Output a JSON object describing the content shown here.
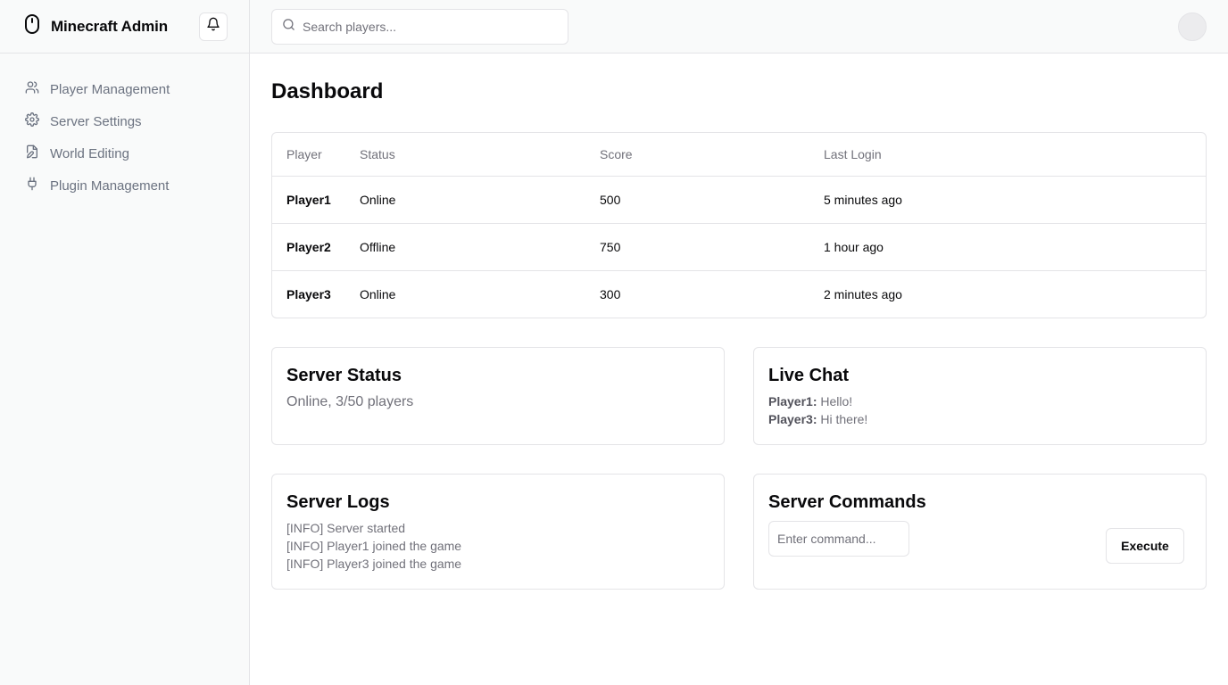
{
  "app": {
    "title": "Minecraft Admin"
  },
  "sidebar": {
    "items": [
      {
        "label": "Player Management",
        "icon": "users-icon"
      },
      {
        "label": "Server Settings",
        "icon": "gear-icon"
      },
      {
        "label": "World Editing",
        "icon": "file-edit-icon"
      },
      {
        "label": "Plugin Management",
        "icon": "plug-icon"
      }
    ]
  },
  "search": {
    "placeholder": "Search players..."
  },
  "main": {
    "title": "Dashboard",
    "table": {
      "headers": [
        "Player",
        "Status",
        "Score",
        "Last Login"
      ],
      "rows": [
        [
          "Player1",
          "Online",
          "500",
          "5 minutes ago"
        ],
        [
          "Player2",
          "Offline",
          "750",
          "1 hour ago"
        ],
        [
          "Player3",
          "Online",
          "300",
          "2 minutes ago"
        ]
      ]
    },
    "server_status": {
      "title": "Server Status",
      "text": "Online, 3/50 players"
    },
    "live_chat": {
      "title": "Live Chat",
      "messages": [
        {
          "user": "Player1:",
          "text": " Hello!"
        },
        {
          "user": "Player3:",
          "text": " Hi there!"
        }
      ]
    },
    "server_logs": {
      "title": "Server Logs",
      "lines": [
        "[INFO] Server started",
        "[INFO] Player1 joined the game",
        "[INFO] Player3 joined the game"
      ]
    },
    "server_commands": {
      "title": "Server Commands",
      "input_placeholder": "Enter command...",
      "execute_label": "Execute"
    }
  }
}
